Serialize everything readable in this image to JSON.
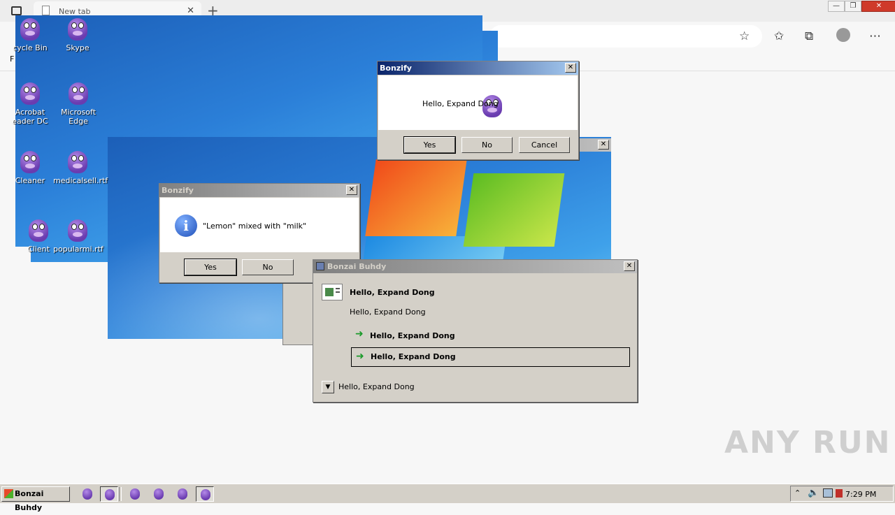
{
  "browser": {
    "tab_title": "New tab",
    "tab_close": "✕",
    "new_tab": "+",
    "favorites_label": "F",
    "win_minimize": "—",
    "win_restore": "❐",
    "win_close": "✕",
    "toolbar_icons": [
      "add-favorite-icon",
      "favorites-icon",
      "collections-icon",
      "profile-icon",
      "more-icon"
    ]
  },
  "desktop": {
    "icons": [
      {
        "label": "cycle Bin"
      },
      {
        "label": "Skype"
      },
      {
        "label": "Acrobat"
      },
      {
        "label": "eader DC"
      },
      {
        "label": "Microsoft Edge"
      },
      {
        "label": "Cleaner"
      },
      {
        "label": "medicalsell.rtf"
      },
      {
        "label": "Client"
      },
      {
        "label": "popularmi.rtf"
      }
    ]
  },
  "dialog_top": {
    "title": "Bonzify",
    "message": "Hello, Expand Dong",
    "buttons": [
      "Yes",
      "No",
      "Cancel"
    ]
  },
  "dialog_left": {
    "title": "Bonzify",
    "message": "\"Lemon\" mixed with \"milk\"",
    "buttons": [
      "Yes",
      "No"
    ]
  },
  "buhdy": {
    "title": "Bonzai Buhdy",
    "heading": "Hello, Expand Dong",
    "subtext": "Hello, Expand Dong",
    "option1": "Hello, Expand Dong",
    "option2": "Hello, Expand Dong",
    "footer": "Hello, Expand Dong"
  },
  "taskbar": {
    "start_label": "Bonzai Buhdy",
    "clock": "7:29 PM",
    "tray_icons": [
      "chevron-up-icon",
      "speaker-icon",
      "network-icon",
      "flag-icon"
    ]
  },
  "watermark": "ANY RUN",
  "colors": {
    "titlebar_active": "#0a246a",
    "titlebar_inactive": "#808080",
    "arrow_green": "#1a9a2a",
    "wallpaper_blue": "#2b7fd8"
  }
}
